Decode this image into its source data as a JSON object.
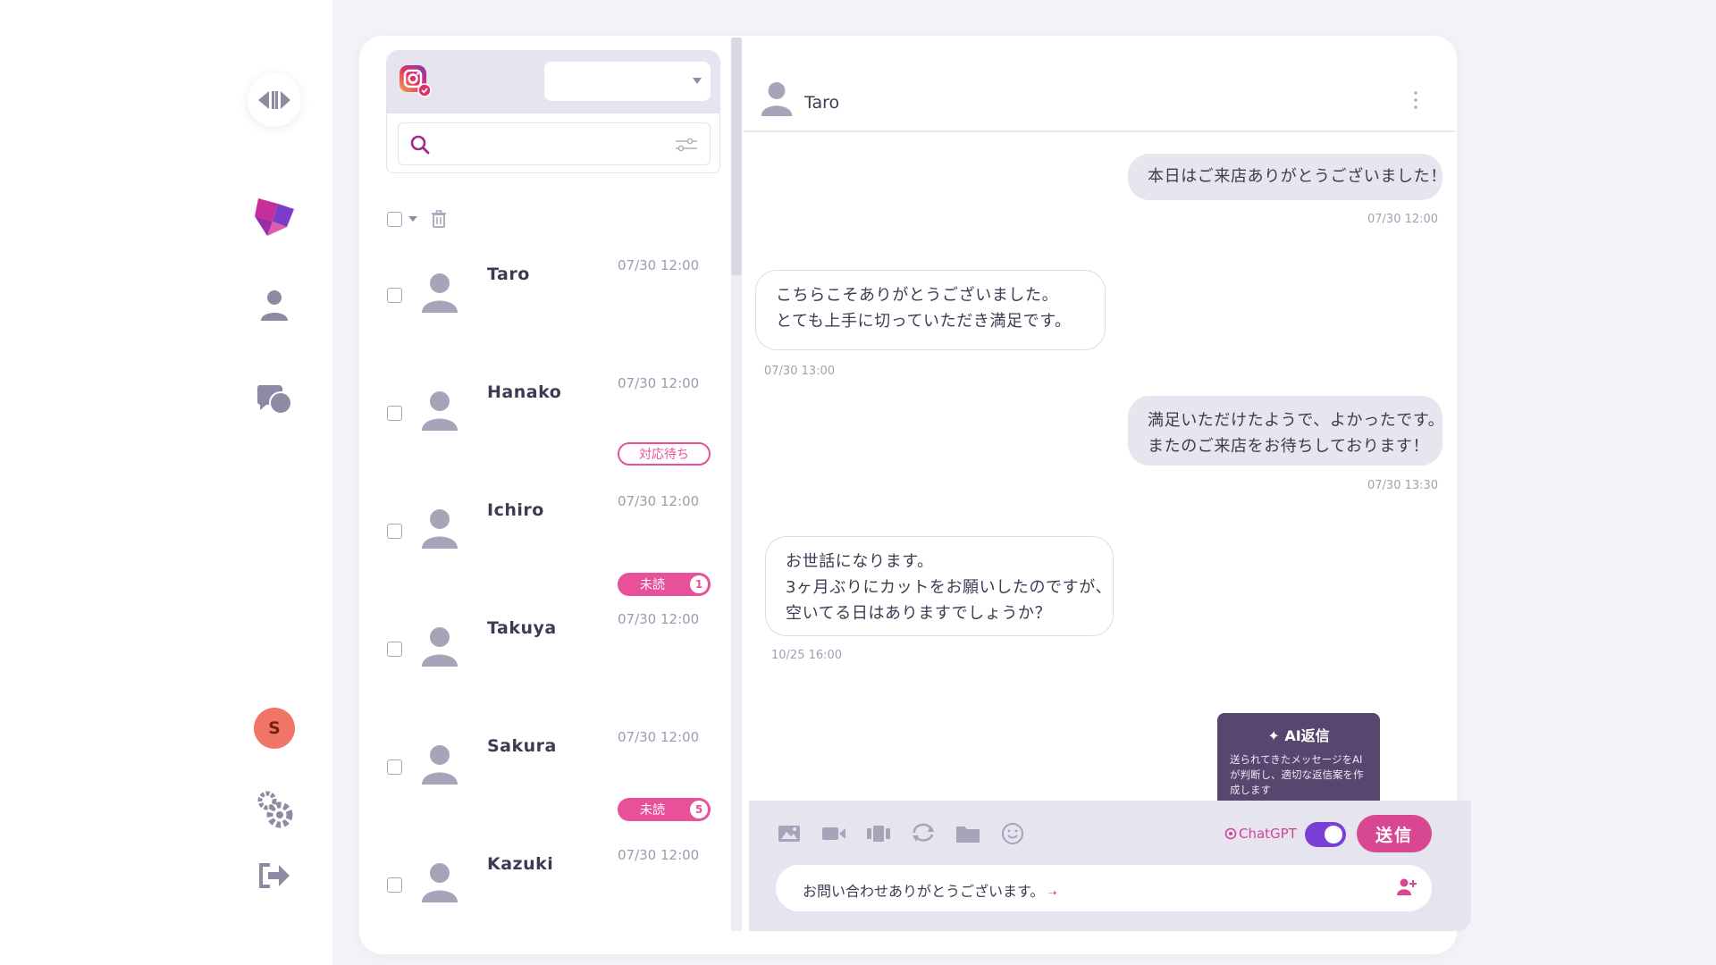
{
  "sidebar": {
    "user_initial": "S"
  },
  "conversations_pane": {
    "search_placeholder": "",
    "account_select_value": "",
    "items": [
      {
        "name": "Taro",
        "time": "07/30 12:00"
      },
      {
        "name": "Hanako",
        "time": "07/30 12:00",
        "status": "対応待ち"
      },
      {
        "name": "Ichiro",
        "time": "07/30 12:00",
        "unread_label": "未読",
        "unread_count": "1"
      },
      {
        "name": "Takuya",
        "time": "07/30 12:00"
      },
      {
        "name": "Sakura",
        "time": "07/30 12:00",
        "unread_label": "未読",
        "unread_count": "5"
      },
      {
        "name": "Kazuki",
        "time": "07/30 12:00"
      }
    ]
  },
  "chat": {
    "contact_name": "Taro",
    "messages": [
      {
        "direction": "out",
        "text": "本日はご来店ありがとうございました！",
        "time": "07/30 12:00"
      },
      {
        "direction": "in",
        "text": "こちらこそありがとうございました。\nとても上手に切っていただき満足です。",
        "time": "07/30 13:00"
      },
      {
        "direction": "out",
        "text": "満足いただけたようで、よかったです。\nまたのご来店をお待ちしております！",
        "time": "07/30 13:30"
      },
      {
        "direction": "in",
        "text": "お世話になります。\n3ヶ月ぶりにカットをお願いしたのですが、\n空いてる日はありますでしょうか？",
        "time": "10/25 16:00"
      }
    ]
  },
  "ai_tooltip": {
    "title": "AI返信",
    "body": "送られてきたメッセージをAIが判断し、適切な返信案を作成します"
  },
  "composer": {
    "chatgpt_label": "ChatGPT",
    "toggle_on": true,
    "send_label": "送信",
    "input_value": "お問い合わせありがとうございます。"
  },
  "colors": {
    "accent_pink": "#e9509a",
    "toggle_purple": "#7a3fd6",
    "tooltip_bg": "#57476e"
  }
}
